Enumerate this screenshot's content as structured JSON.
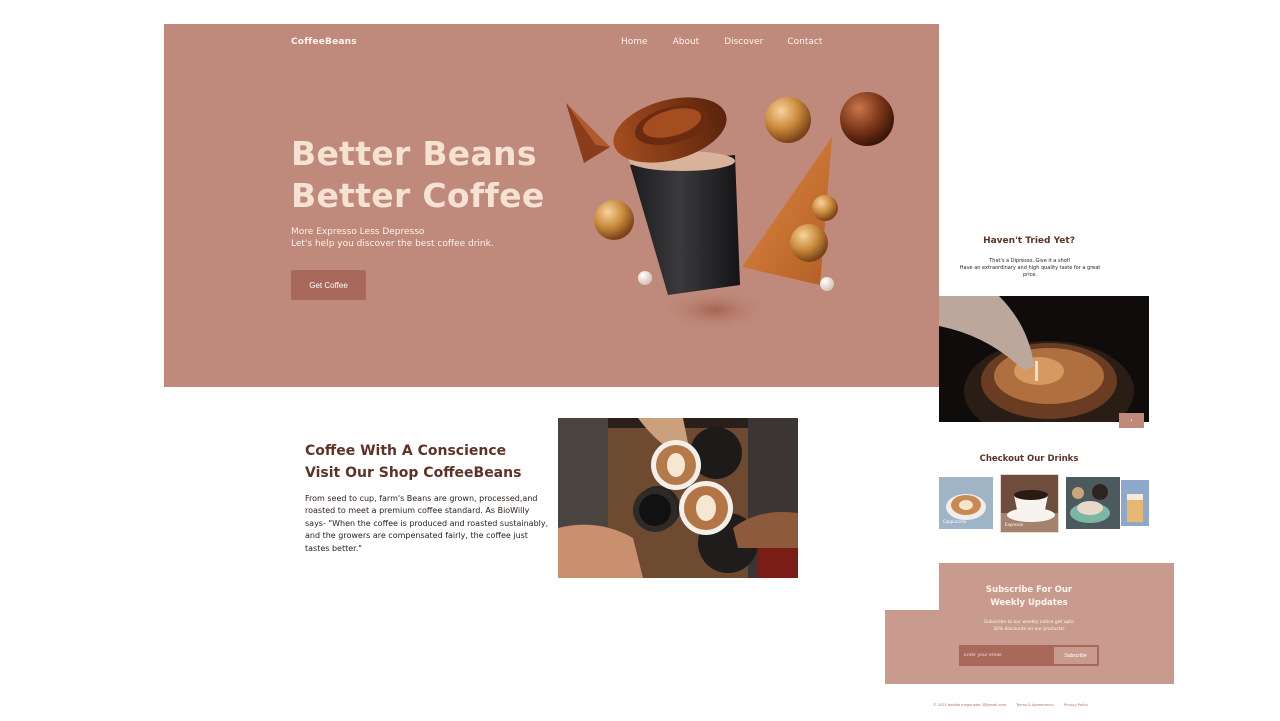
{
  "brand": "CoffeeBeans",
  "nav": {
    "home": "Home",
    "about": "About",
    "discover": "Discover",
    "contact": "Contact"
  },
  "hero": {
    "title_line1": "Better Beans",
    "title_line2": "Better Coffee",
    "sub_line1": "More Expresso Less Depresso",
    "sub_line2": "Let's help you discover the best coffee drink.",
    "cta": "Get Coffee"
  },
  "about": {
    "title_line1": "Coffee With A Conscience",
    "title_line2": "Visit Our Shop CoffeeBeans",
    "paragraph": "From seed to cup, farm's Beans are grown, processed,and roasted to meet a premium coffee standard. As BioWilly says- \"When the coffee is produced and roasted sustainably, and the growers are compensated fairly, the coffee just tastes better.\""
  },
  "promo": {
    "title": "Haven't Tried Yet?",
    "line1": "That's a Dipresso..Give it a shot!",
    "line2": "Have an extraordinary and high quality taste for a great price.",
    "next": "›"
  },
  "drinks": {
    "title": "Checkout Our Drinks",
    "items": [
      {
        "label": "Cappuccino"
      },
      {
        "label": "Expresso"
      },
      {
        "label": ""
      },
      {
        "label": ""
      }
    ]
  },
  "subscribe": {
    "title_line1": "Subscribe For Our",
    "title_line2": "Weekly Updates",
    "text_line1": "Subscribe to our weekly notice get upto",
    "text_line2": "30% discounts on our products!",
    "placeholder": "Enter your email",
    "button": "Subscribe"
  },
  "footer": {
    "copyright": "© 2021 bobika meganaba 3@gmail.com",
    "terms": "Terms & Agreements",
    "privacy": "Privacy Policy"
  },
  "colors": {
    "hero_bg": "#bf8a7b",
    "accent": "#a8685a",
    "heading": "#5e3326",
    "subscribe_bg": "#c89b8e"
  }
}
